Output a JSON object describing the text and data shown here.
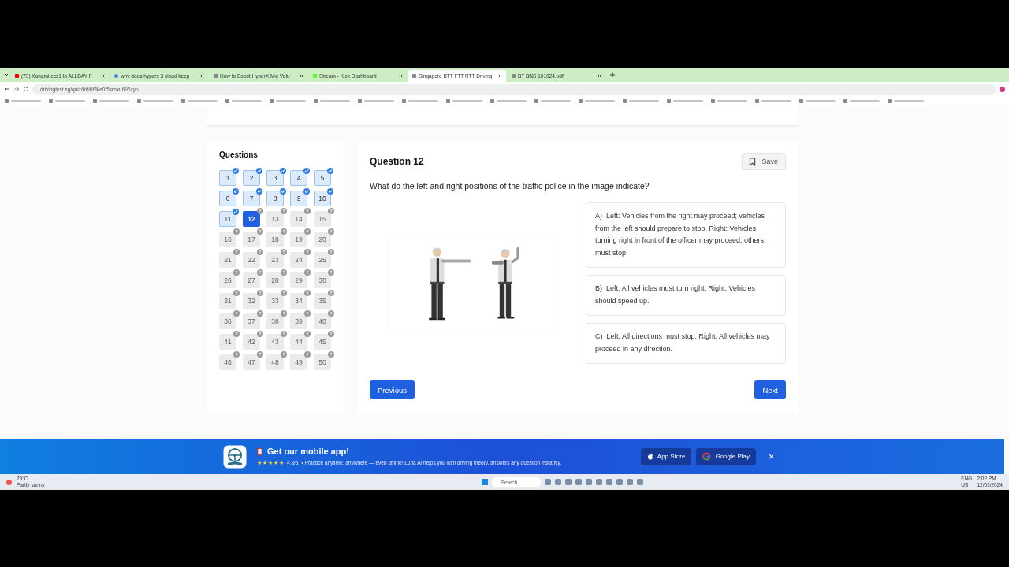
{
  "browser": {
    "tabs": [
      {
        "title": "(73) Konami ecs1 to ALLDAY F",
        "selected": false,
        "kind": "video"
      },
      {
        "title": "why does hyperx 3 cloud keep",
        "selected": false,
        "kind": "search"
      },
      {
        "title": "How to Boost HyperX Mic Volu",
        "selected": false,
        "kind": "web"
      },
      {
        "title": "Stream - Kick Dashboard",
        "selected": false,
        "kind": "stream"
      },
      {
        "title": "Singapore BTT FTT RTT Driving",
        "selected": true,
        "kind": "web"
      },
      {
        "title": "BT BNS 101024.pdf",
        "selected": false,
        "kind": "web"
      }
    ],
    "url": "drivingtest.sg/quiz/btt/6f3ke0f5srnxu696zyp"
  },
  "sidebar": {
    "title": "Questions",
    "items": [
      {
        "number": "1",
        "answered": true,
        "selected": false
      },
      {
        "number": "2",
        "answered": true,
        "selected": false
      },
      {
        "number": "3",
        "answered": true,
        "selected": false
      },
      {
        "number": "4",
        "answered": true,
        "selected": false
      },
      {
        "number": "5",
        "answered": true,
        "selected": false
      },
      {
        "number": "6",
        "answered": true,
        "selected": false
      },
      {
        "number": "7",
        "answered": true,
        "selected": false
      },
      {
        "number": "8",
        "answered": true,
        "selected": false
      },
      {
        "number": "9",
        "answered": true,
        "selected": false
      },
      {
        "number": "10",
        "answered": true,
        "selected": false
      },
      {
        "number": "11",
        "answered": true,
        "selected": false
      },
      {
        "number": "12",
        "answered": false,
        "selected": true
      },
      {
        "number": "13",
        "answered": false,
        "selected": false
      },
      {
        "number": "14",
        "answered": false,
        "selected": false
      },
      {
        "number": "15",
        "answered": false,
        "selected": false
      },
      {
        "number": "16",
        "answered": false,
        "selected": false
      },
      {
        "number": "17",
        "answered": false,
        "selected": false
      },
      {
        "number": "18",
        "answered": false,
        "selected": false
      },
      {
        "number": "19",
        "answered": false,
        "selected": false
      },
      {
        "number": "20",
        "answered": false,
        "selected": false
      },
      {
        "number": "21",
        "answered": false,
        "selected": false
      },
      {
        "number": "22",
        "answered": false,
        "selected": false
      },
      {
        "number": "23",
        "answered": false,
        "selected": false
      },
      {
        "number": "24",
        "answered": false,
        "selected": false
      },
      {
        "number": "25",
        "answered": false,
        "selected": false
      },
      {
        "number": "26",
        "answered": false,
        "selected": false
      },
      {
        "number": "27",
        "answered": false,
        "selected": false
      },
      {
        "number": "28",
        "answered": false,
        "selected": false
      },
      {
        "number": "29",
        "answered": false,
        "selected": false
      },
      {
        "number": "30",
        "answered": false,
        "selected": false
      },
      {
        "number": "31",
        "answered": false,
        "selected": false
      },
      {
        "number": "32",
        "answered": false,
        "selected": false
      },
      {
        "number": "33",
        "answered": false,
        "selected": false
      },
      {
        "number": "34",
        "answered": false,
        "selected": false
      },
      {
        "number": "35",
        "answered": false,
        "selected": false
      },
      {
        "number": "36",
        "answered": false,
        "selected": false
      },
      {
        "number": "37",
        "answered": false,
        "selected": false
      },
      {
        "number": "38",
        "answered": false,
        "selected": false
      },
      {
        "number": "39",
        "answered": false,
        "selected": false
      },
      {
        "number": "40",
        "answered": false,
        "selected": false
      },
      {
        "number": "41",
        "answered": false,
        "selected": false
      },
      {
        "number": "42",
        "answered": false,
        "selected": false
      },
      {
        "number": "43",
        "answered": false,
        "selected": false
      },
      {
        "number": "44",
        "answered": false,
        "selected": false
      },
      {
        "number": "45",
        "answered": false,
        "selected": false
      },
      {
        "number": "46",
        "answered": false,
        "selected": false
      },
      {
        "number": "47",
        "answered": false,
        "selected": false
      },
      {
        "number": "48",
        "answered": false,
        "selected": false
      },
      {
        "number": "49",
        "answered": false,
        "selected": false
      },
      {
        "number": "50",
        "answered": false,
        "selected": false
      }
    ]
  },
  "question": {
    "title": "Question 12",
    "save": "Save",
    "text": "What do the left and right positions of the traffic police in the image indicate?",
    "options": [
      {
        "letter": "A)",
        "text": "Left: Vehicles from the right may proceed; vehicles from the left should prepare to stop. Right: Vehicles turning right in front of the officer may proceed; others must stop."
      },
      {
        "letter": "B)",
        "text": "Left: All vehicles must turn right. Right: Vehicles should speed up."
      },
      {
        "letter": "C)",
        "text": "Left: All directions must stop. Right: All vehicles may proceed in any direction."
      }
    ],
    "previous": "Previous",
    "next": "Next"
  },
  "banner": {
    "title": "Get our mobile app!",
    "stars": 5,
    "rating": "4.8/5",
    "text": "• Practice anytime, anywhere — even offline! Luna AI helps you with driving theory, answers any question instantly.",
    "app_store": "App Store",
    "google_play": "Google Play",
    "close": "×"
  },
  "taskbar": {
    "temperature": "29°C",
    "weather": "Partly sunny",
    "search": "Search",
    "language": "ENG",
    "region": "US",
    "time": "2:02 PM",
    "date": "12/03/2024"
  }
}
